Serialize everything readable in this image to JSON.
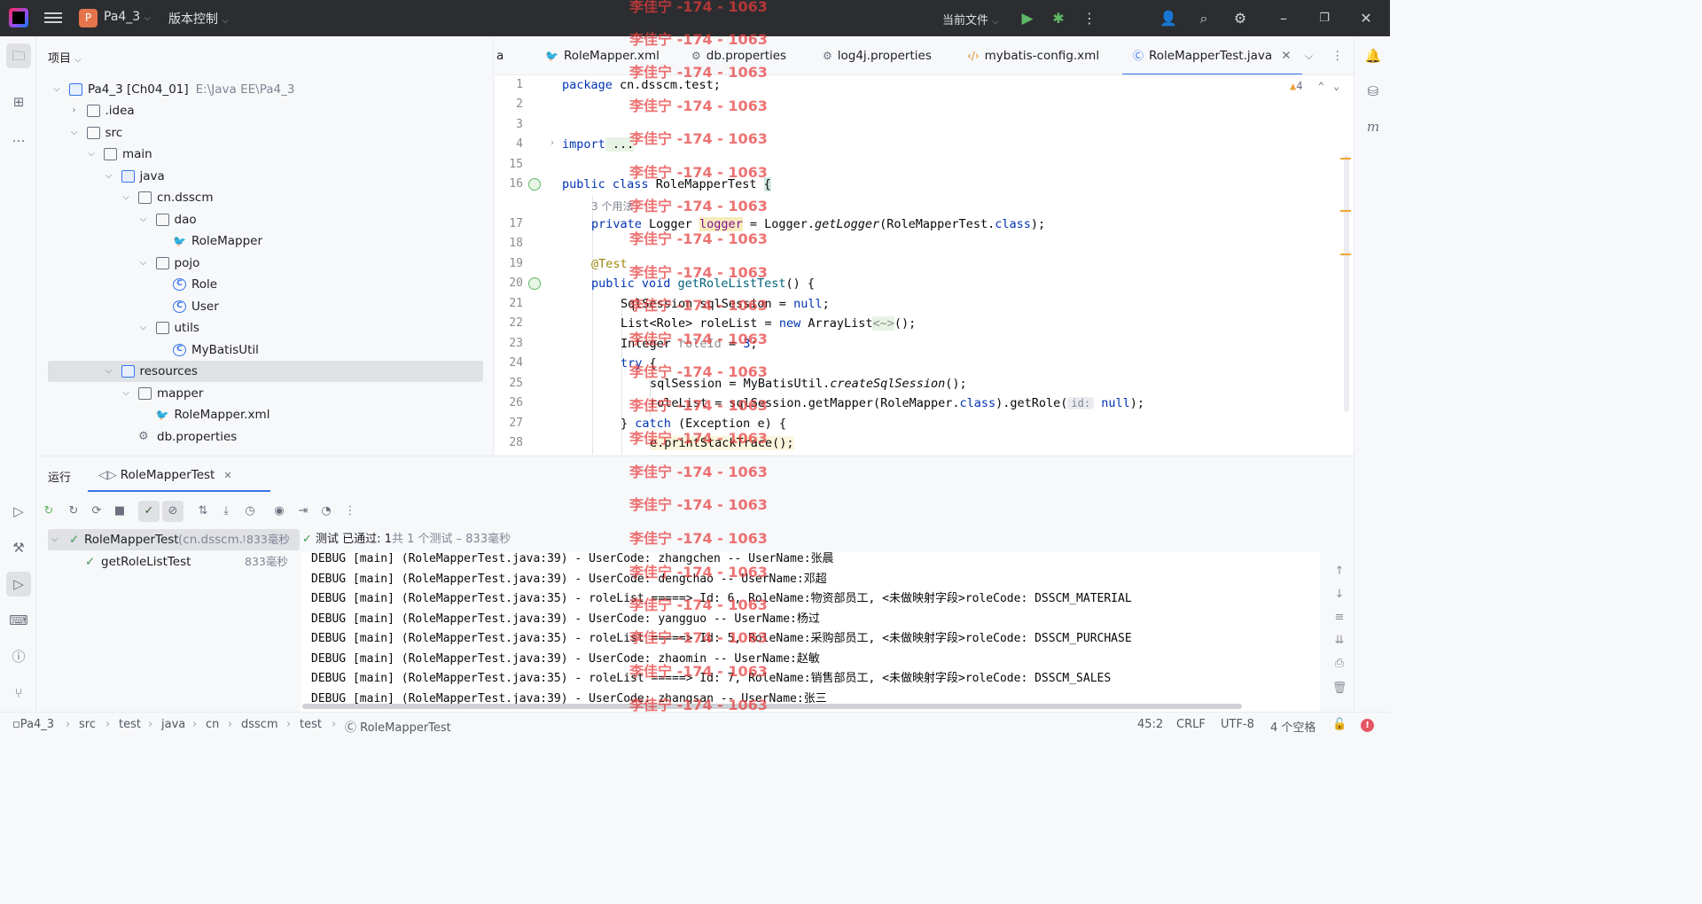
{
  "titlebar": {
    "project_badge": "P",
    "project_name": "Pa4_3",
    "vcs_menu": "版本控制",
    "run_config": "当前文件"
  },
  "project_panel": {
    "title": "项目",
    "tree": [
      {
        "label": "Pa4_3 [Ch04_01]",
        "hint": "E:\\Java EE\\Pa4_3",
        "type": "module",
        "arrow": "down"
      },
      {
        "label": ".idea",
        "type": "folder",
        "arrow": "right"
      },
      {
        "label": "src",
        "type": "folder",
        "arrow": "down"
      },
      {
        "label": "main",
        "type": "folder",
        "arrow": "down"
      },
      {
        "label": "java",
        "type": "source-folder",
        "arrow": "down"
      },
      {
        "label": "cn.dsscm",
        "type": "package",
        "arrow": "down"
      },
      {
        "label": "dao",
        "type": "package",
        "arrow": "down"
      },
      {
        "label": "RoleMapper",
        "type": "mybatis",
        "arrow": ""
      },
      {
        "label": "pojo",
        "type": "package",
        "arrow": "down"
      },
      {
        "label": "Role",
        "type": "class",
        "arrow": ""
      },
      {
        "label": "User",
        "type": "class",
        "arrow": ""
      },
      {
        "label": "utils",
        "type": "package",
        "arrow": "down"
      },
      {
        "label": "MyBatisUtil",
        "type": "class",
        "arrow": ""
      },
      {
        "label": "resources",
        "type": "resources-folder",
        "arrow": "down",
        "selected": true
      },
      {
        "label": "mapper",
        "type": "folder",
        "arrow": "down"
      },
      {
        "label": "RoleMapper.xml",
        "type": "mybatis",
        "arrow": ""
      },
      {
        "label": "db.properties",
        "type": "properties",
        "arrow": ""
      }
    ]
  },
  "tabs": [
    {
      "label": "a",
      "icon": ""
    },
    {
      "label": "RoleMapper.xml",
      "icon": "mybatis-icon"
    },
    {
      "label": "db.properties",
      "icon": "gear-icon"
    },
    {
      "label": "log4j.properties",
      "icon": "gear-icon"
    },
    {
      "label": "mybatis-config.xml",
      "icon": "xml-icon"
    },
    {
      "label": "RoleMapperTest.java",
      "icon": "class-icon",
      "active": true
    }
  ],
  "editor": {
    "warning_count": "4",
    "usages_hint": "3 个用法",
    "line_numbers": [
      "1",
      "2",
      "3",
      "4",
      "15",
      "16",
      "",
      "17",
      "18",
      "19",
      "20",
      "21",
      "22",
      "23",
      "24",
      "25",
      "26",
      "27",
      "28"
    ],
    "lines": {
      "l1": [
        "package",
        " cn.dsscm.test;"
      ],
      "l4": [
        "import",
        " ..."
      ],
      "l16": [
        "public",
        " class",
        " RoleMapperTest ",
        "{"
      ],
      "l17": [
        "private",
        " Logger ",
        "logger",
        " = Logger.",
        "getLogger",
        "(RoleMapperTest.",
        "class",
        ");"
      ],
      "l19": "@Test",
      "l20": [
        "public",
        " void",
        " getRoleListTest",
        "() {"
      ],
      "l21": [
        "SqlSession sqlSession = ",
        "null",
        ";"
      ],
      "l22": [
        "List<Role> roleList = ",
        "new",
        " ArrayList",
        "<~>",
        "();"
      ],
      "l23": [
        "Integer ",
        "roleId",
        " = ",
        "3",
        ";"
      ],
      "l24": [
        "try",
        " {"
      ],
      "l25": [
        "sqlSession = MyBatisUtil.",
        "createSqlSession",
        "();"
      ],
      "l26": [
        "roleList = sqlSession.getMapper(RoleMapper.",
        "class",
        ").getRole(",
        "id:",
        " ",
        "null",
        ");"
      ],
      "l27": [
        "} ",
        "catch",
        " (Exception e) {"
      ],
      "l28": "e.printStackTrace();"
    }
  },
  "run_panel": {
    "title": "运行",
    "tab_label": "RoleMapperTest",
    "status_prefix": "测试 已通过: ",
    "status_count": "1",
    "status_rest": "共 1 个测试 – 833毫秒",
    "tests": [
      {
        "name": "RoleMapperTest",
        "hint": "(cn.dsscm.t",
        "time": "833毫秒"
      },
      {
        "name": "getRoleListTest",
        "hint": "",
        "time": "833毫秒"
      }
    ],
    "console": [
      "DEBUG [main] (RoleMapperTest.java:39) - UserCode: zhangchen -- UserName:张晨",
      "DEBUG [main] (RoleMapperTest.java:39) - UserCode: dengchao -- UserName:邓超",
      "DEBUG [main] (RoleMapperTest.java:35) - roleList =====> Id: 6, RoleName:物资部员工, <未做映射字段>roleCode: DSSCM_MATERIAL",
      "DEBUG [main] (RoleMapperTest.java:39) - UserCode: yangguo -- UserName:杨过",
      "DEBUG [main] (RoleMapperTest.java:35) - roleList =====> Id: 5, RoleName:采购部员工, <未做映射字段>roleCode: DSSCM_PURCHASE",
      "DEBUG [main] (RoleMapperTest.java:39) - UserCode: zhaomin -- UserName:赵敏",
      "DEBUG [main] (RoleMapperTest.java:35) - roleList =====> Id: 7, RoleName:销售部员工, <未做映射字段>roleCode: DSSCM_SALES",
      "DEBUG [main] (RoleMapperTest.java:39) - UserCode: zhangsan -- UserName:张三"
    ]
  },
  "statusbar": {
    "breadcrumbs": [
      "Pa4_3",
      "src",
      "test",
      "java",
      "cn",
      "dsscm",
      "test",
      "RoleMapperTest"
    ],
    "position": "45:2",
    "line_ending": "CRLF",
    "encoding": "UTF-8",
    "indent": "4 个空格"
  },
  "watermark": "李佳宁 -174 - 1063",
  "colors": {
    "accent": "#3574f0",
    "keyword": "#0033b3",
    "success": "#3d9a50",
    "watermark": "#e63c3c"
  }
}
